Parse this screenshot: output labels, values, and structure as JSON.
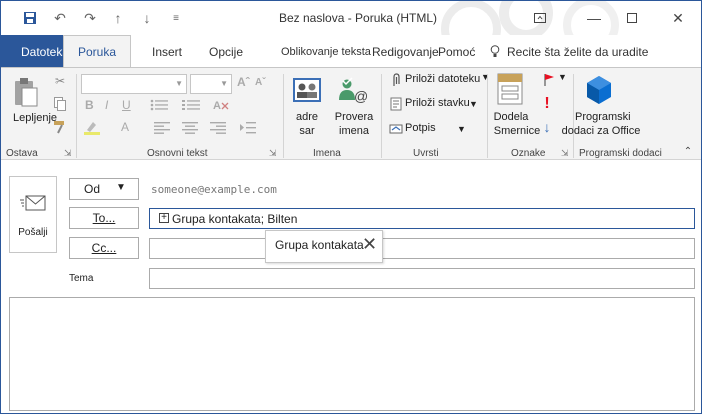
{
  "title_bar": {
    "title": "Bez naslova - Poruka (HTML)"
  },
  "tabs": [
    {
      "label": "Datoteka"
    },
    {
      "label": "Poruka"
    },
    {
      "label": "Insert"
    },
    {
      "label": "Opcije"
    },
    {
      "label": "Oblikovanje teksta"
    },
    {
      "label": "Redigovanje"
    },
    {
      "label": "Pomoć"
    }
  ],
  "tell_me": "Recite šta želite da uradite",
  "ribbon": {
    "groups": {
      "clipboard": "Ostava",
      "basic_text": "Osnovni tekst",
      "names": "Imena",
      "include": "Uvrsti",
      "tags": "Oznake",
      "addins": "Programski dodaci"
    },
    "paste_label": "Lepljenje",
    "address_book_line1": "adre",
    "address_book_line2": "sar",
    "check_names_line1": "Provera",
    "check_names_line2": "imena",
    "attach_file": "Priloži datoteku",
    "attach_item": "Priloži stavku",
    "signature": "Potpis",
    "assign_policy_line1": "Dodela",
    "assign_policy_line2": "Smernice",
    "office_addins_line1": "Programski",
    "office_addins_line2": "dodaci za Office"
  },
  "compose": {
    "send_label": "Pošalji",
    "from_label": "Od",
    "from_value": "someone@example.com",
    "to_label": "To...",
    "to_value": "Grupa kontakata; Bilten",
    "cc_label": "Cc...",
    "subject_label": "Tema",
    "tooltip_text": "Grupa kontakata"
  },
  "colors": {
    "accent": "#2b579a",
    "ribbon_bg": "#f3f3f3",
    "flag_red": "#e81123",
    "addins_blue": "#0a6ed1"
  }
}
